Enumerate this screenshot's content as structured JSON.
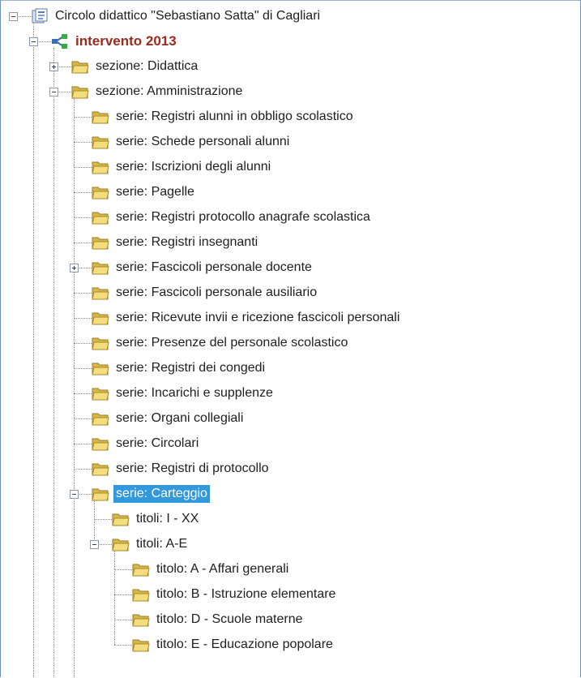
{
  "tree": {
    "nodes": [
      {
        "label": "Circolo didattico \"Sebastiano Satta\" di Cagliari",
        "depth": 0,
        "toggle": "minus",
        "icon": "archive-root-icon",
        "style": "normal"
      },
      {
        "label": "intervento 2013",
        "depth": 1,
        "toggle": "minus",
        "icon": "structure-network-icon",
        "style": "bold"
      },
      {
        "label": "sezione: Didattica",
        "depth": 2,
        "toggle": "plus",
        "icon": "folder-icon",
        "style": "normal"
      },
      {
        "label": "sezione: Amministrazione",
        "depth": 2,
        "toggle": "minus",
        "icon": "folder-icon",
        "style": "normal"
      },
      {
        "label": "serie: Registri alunni in obbligo scolastico",
        "depth": 3,
        "toggle": "none",
        "icon": "folder-icon",
        "style": "normal"
      },
      {
        "label": "serie: Schede personali alunni",
        "depth": 3,
        "toggle": "none",
        "icon": "folder-icon",
        "style": "normal"
      },
      {
        "label": "serie: Iscrizioni degli alunni",
        "depth": 3,
        "toggle": "none",
        "icon": "folder-icon",
        "style": "normal"
      },
      {
        "label": "serie: Pagelle",
        "depth": 3,
        "toggle": "none",
        "icon": "folder-icon",
        "style": "normal"
      },
      {
        "label": "serie: Registri protocollo anagrafe scolastica",
        "depth": 3,
        "toggle": "none",
        "icon": "folder-icon",
        "style": "normal"
      },
      {
        "label": "serie: Registri insegnanti",
        "depth": 3,
        "toggle": "none",
        "icon": "folder-icon",
        "style": "normal"
      },
      {
        "label": "serie: Fascicoli personale docente",
        "depth": 3,
        "toggle": "plus",
        "icon": "folder-icon",
        "style": "normal"
      },
      {
        "label": "serie: Fascicoli personale ausiliario",
        "depth": 3,
        "toggle": "none",
        "icon": "folder-icon",
        "style": "normal"
      },
      {
        "label": "serie: Ricevute invii e ricezione fascicoli personali",
        "depth": 3,
        "toggle": "none",
        "icon": "folder-icon",
        "style": "normal"
      },
      {
        "label": "serie: Presenze del personale scolastico",
        "depth": 3,
        "toggle": "none",
        "icon": "folder-icon",
        "style": "normal"
      },
      {
        "label": "serie: Registri dei congedi",
        "depth": 3,
        "toggle": "none",
        "icon": "folder-icon",
        "style": "normal"
      },
      {
        "label": "serie: Incarichi e supplenze",
        "depth": 3,
        "toggle": "none",
        "icon": "folder-icon",
        "style": "normal"
      },
      {
        "label": "serie: Organi collegiali",
        "depth": 3,
        "toggle": "none",
        "icon": "folder-icon",
        "style": "normal"
      },
      {
        "label": "serie: Circolari",
        "depth": 3,
        "toggle": "none",
        "icon": "folder-icon",
        "style": "normal"
      },
      {
        "label": "serie: Registri di protocollo",
        "depth": 3,
        "toggle": "none",
        "icon": "folder-icon",
        "style": "normal"
      },
      {
        "label": "serie: Carteggio",
        "depth": 3,
        "toggle": "minus",
        "icon": "folder-icon",
        "style": "selected"
      },
      {
        "label": "titoli: I - XX",
        "depth": 4,
        "toggle": "none",
        "icon": "folder-icon",
        "style": "normal"
      },
      {
        "label": "titoli: A-E",
        "depth": 4,
        "toggle": "minus",
        "icon": "folder-icon",
        "style": "normal"
      },
      {
        "label": "titolo: A - Affari generali",
        "depth": 5,
        "toggle": "none",
        "icon": "folder-icon",
        "style": "normal"
      },
      {
        "label": "titolo: B - Istruzione elementare",
        "depth": 5,
        "toggle": "none",
        "icon": "folder-icon",
        "style": "normal"
      },
      {
        "label": "titolo: D - Scuole materne",
        "depth": 5,
        "toggle": "none",
        "icon": "folder-icon",
        "style": "normal"
      },
      {
        "label": "titolo: E - Educazione popolare",
        "depth": 5,
        "toggle": "none",
        "icon": "folder-icon",
        "style": "normal"
      }
    ]
  },
  "colors": {
    "selection": "#3399dd",
    "bold_label": "#9b2a1f",
    "frame_border": "#6f8fbf"
  }
}
